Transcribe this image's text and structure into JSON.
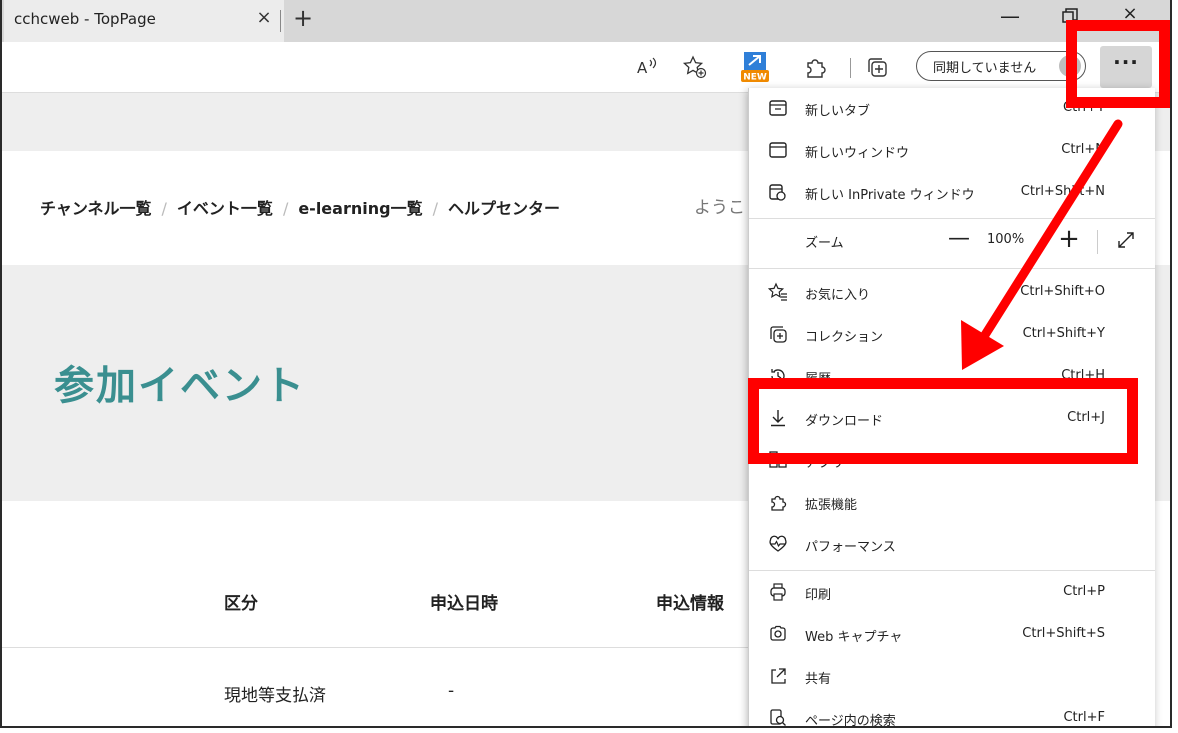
{
  "browser": {
    "tab_title": "cchcweb - TopPage",
    "tab_close": "×",
    "new_tab": "+",
    "minimize": "—",
    "close": "×",
    "sync_label": "同期していません",
    "more_label": "···",
    "new_badge": "NEW"
  },
  "nav": {
    "items": [
      "チャンネル一覧",
      "イベント一覧",
      "e-learning一覧",
      "ヘルプセンター"
    ],
    "separator": "/",
    "welcome": "ようこ"
  },
  "page": {
    "title": "参加イベント",
    "table": {
      "headers": [
        "区分",
        "申込日時",
        "申込情報"
      ],
      "rows": [
        [
          "現地等支払済",
          "-"
        ]
      ]
    }
  },
  "menu": {
    "items": [
      {
        "label": "新しいタブ",
        "shortcut": "Ctrl+T",
        "icon": "new-tab-icon"
      },
      {
        "label": "新しいウィンドウ",
        "shortcut": "Ctrl+N",
        "icon": "window-icon"
      },
      {
        "label": "新しい InPrivate ウィンドウ",
        "shortcut": "Ctrl+Shift+N",
        "icon": "inprivate-icon"
      },
      {
        "label": "お気に入り",
        "shortcut": "Ctrl+Shift+O",
        "icon": "favorites-icon"
      },
      {
        "label": "コレクション",
        "shortcut": "Ctrl+Shift+Y",
        "icon": "collections-icon"
      },
      {
        "label": "履歴",
        "shortcut": "Ctrl+H",
        "icon": "history-icon"
      },
      {
        "label": "ダウンロード",
        "shortcut": "Ctrl+J",
        "icon": "download-icon"
      },
      {
        "label": "アプリ",
        "shortcut": "",
        "icon": "apps-icon"
      },
      {
        "label": "拡張機能",
        "shortcut": "",
        "icon": "extensions-icon"
      },
      {
        "label": "パフォーマンス",
        "shortcut": "",
        "icon": "performance-icon"
      },
      {
        "label": "印刷",
        "shortcut": "Ctrl+P",
        "icon": "print-icon"
      },
      {
        "label": "Web キャプチャ",
        "shortcut": "Ctrl+Shift+S",
        "icon": "web-capture-icon"
      },
      {
        "label": "共有",
        "shortcut": "",
        "icon": "share-icon"
      },
      {
        "label": "ページ内の検索",
        "shortcut": "Ctrl+F",
        "icon": "find-icon"
      }
    ],
    "zoom": {
      "label": "ズーム",
      "value": "100%",
      "minus": "—",
      "plus": "+"
    }
  },
  "colors": {
    "accent_teal": "#3a8f90",
    "highlight_red": "#ff0000"
  }
}
